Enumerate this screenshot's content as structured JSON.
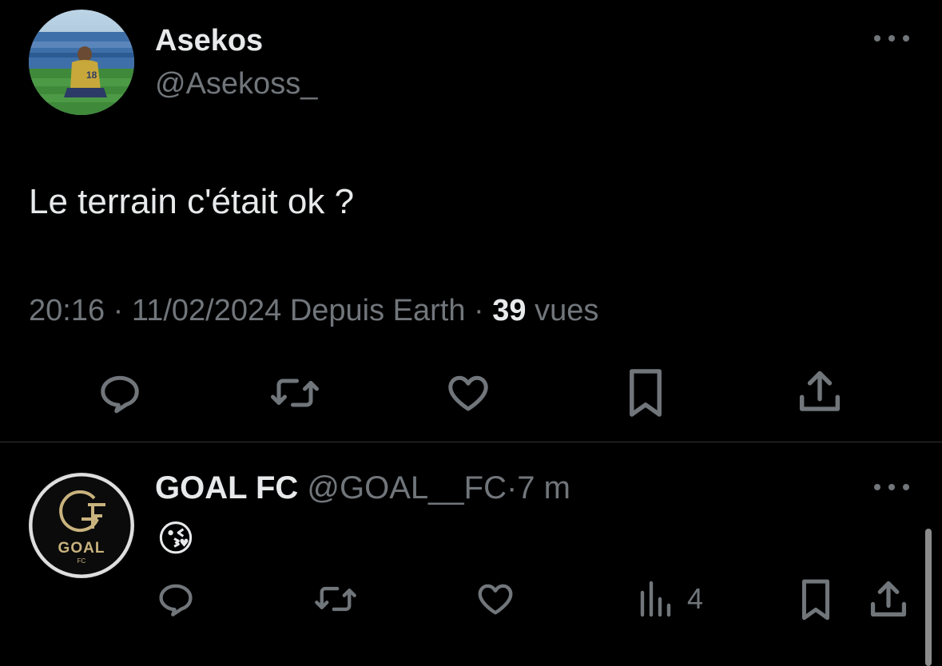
{
  "tweet": {
    "author_name": "Asekos",
    "author_handle": "@Asekoss_",
    "text": "Le terrain c'était ok ?",
    "time": "20:16",
    "date": "11/02/2024",
    "source": "Depuis Earth",
    "views_count": "39",
    "views_label": "vues",
    "separator": "·",
    "actions": [
      "reply-icon",
      "retweet-icon",
      "like-icon",
      "bookmark-icon",
      "share-icon"
    ]
  },
  "reply": {
    "author_name": "GOAL FC",
    "author_handle": "@GOAL__FC",
    "separator": "·",
    "age": "7 m",
    "text": "😘",
    "logo_text": "GOAL",
    "logo_sub": "FC",
    "views_count": "4",
    "actions": [
      "reply-icon",
      "retweet-icon",
      "like-icon",
      "views-icon",
      "bookmark-icon",
      "share-icon"
    ]
  },
  "colors": {
    "background": "#000000",
    "text": "#e7e9ea",
    "muted": "#71767b",
    "divider": "#2f3336",
    "logo_gold": "#c9b37e"
  }
}
